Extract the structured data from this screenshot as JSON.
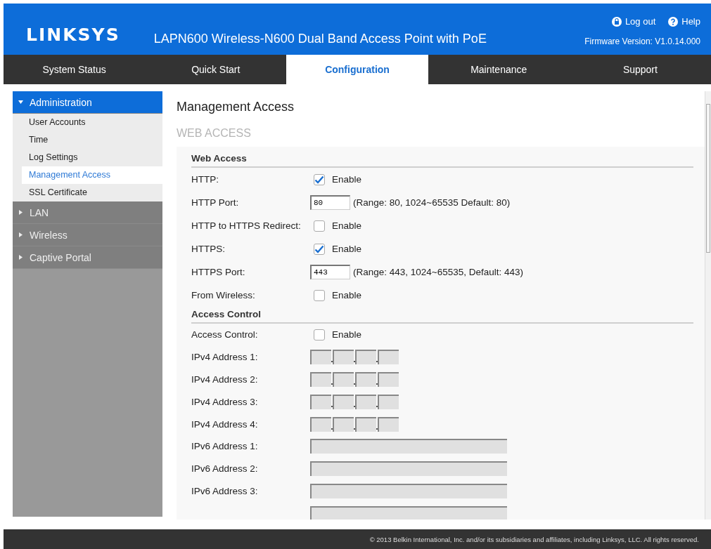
{
  "header": {
    "logo": "LINKSYS",
    "product": "LAPN600 Wireless-N600 Dual Band Access Point with PoE",
    "logout": "Log out",
    "help": "Help",
    "firmware": "Firmware Version: V1.0.14.000"
  },
  "tabs": [
    {
      "label": "System Status",
      "selected": false
    },
    {
      "label": "Quick Start",
      "selected": false
    },
    {
      "label": "Configuration",
      "selected": true
    },
    {
      "label": "Maintenance",
      "selected": false
    },
    {
      "label": "Support",
      "selected": false
    }
  ],
  "sidebar": {
    "items": [
      {
        "label": "Administration",
        "expanded": true,
        "children": [
          {
            "label": "User Accounts",
            "selected": false
          },
          {
            "label": "Time",
            "selected": false
          },
          {
            "label": "Log Settings",
            "selected": false
          },
          {
            "label": "Management Access",
            "selected": true
          },
          {
            "label": "SSL Certificate",
            "selected": false
          }
        ]
      },
      {
        "label": "LAN",
        "expanded": false
      },
      {
        "label": "Wireless",
        "expanded": false
      },
      {
        "label": "Captive Portal",
        "expanded": false
      }
    ]
  },
  "page": {
    "title": "Management Access",
    "section": "WEB ACCESS",
    "groups": [
      {
        "heading": "Web Access",
        "rows": [
          {
            "kind": "checkbox",
            "label": "HTTP:",
            "checked": true,
            "option": "Enable"
          },
          {
            "kind": "port",
            "label": "HTTP Port:",
            "value": "80",
            "hint": "(Range: 80, 1024~65535 Default: 80)"
          },
          {
            "kind": "checkbox",
            "label": "HTTP to HTTPS Redirect:",
            "checked": false,
            "option": "Enable"
          },
          {
            "kind": "checkbox",
            "label": "HTTPS:",
            "checked": true,
            "option": "Enable"
          },
          {
            "kind": "port",
            "label": "HTTPS Port:",
            "value": "443",
            "hint": "(Range: 443, 1024~65535, Default: 443)"
          },
          {
            "kind": "checkbox",
            "label": "From Wireless:",
            "checked": false,
            "option": "Enable"
          }
        ]
      },
      {
        "heading": "Access Control",
        "rows": [
          {
            "kind": "checkbox",
            "label": "Access Control:",
            "checked": false,
            "option": "Enable"
          },
          {
            "kind": "ipv4",
            "label": "IPv4 Address 1:"
          },
          {
            "kind": "ipv4",
            "label": "IPv4 Address 2:"
          },
          {
            "kind": "ipv4",
            "label": "IPv4 Address 3:"
          },
          {
            "kind": "ipv4",
            "label": "IPv4 Address 4:"
          },
          {
            "kind": "ipv6",
            "label": "IPv6 Address 1:"
          },
          {
            "kind": "ipv6",
            "label": "IPv6 Address 2:"
          },
          {
            "kind": "ipv6",
            "label": "IPv6 Address 3:"
          },
          {
            "kind": "ipv6"
          }
        ]
      }
    ]
  },
  "footer": "© 2013 Belkin International, Inc. and/or its subsidiaries and affiliates, including Linksys, LLC. All rights reserved."
}
